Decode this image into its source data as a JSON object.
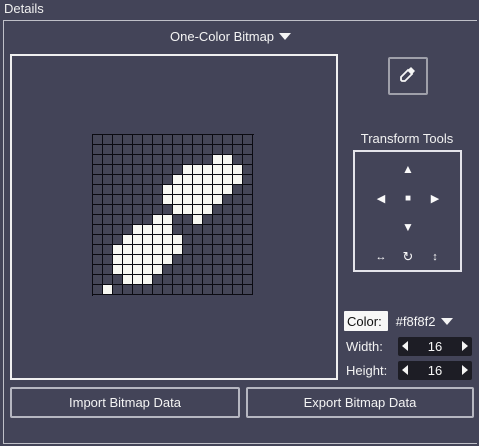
{
  "panel": {
    "title": "Details"
  },
  "mode": {
    "selected": "One-Color Bitmap",
    "icon": "chevron-down-icon"
  },
  "bitmap": {
    "rows": [
      "0000000000000000",
      "0000000000000000",
      "0000000000001100",
      "0000000001111110",
      "0000000011111110",
      "0000000111111100",
      "0000000111111000",
      "0000000011110000",
      "0000001100100000",
      "0000111100000000",
      "0001111110000000",
      "0011111110000000",
      "0011111100000000",
      "0011111000000000",
      "0001110000000000",
      "0100000000000000"
    ],
    "on_color": "#f8f8f2",
    "off_color": "#454657"
  },
  "picker": {
    "icon": "eyedropper-icon"
  },
  "transform": {
    "label": "Transform Tools",
    "buttons": {
      "up": "▲",
      "left": "◀",
      "center": "■",
      "right": "▶",
      "down": "▼",
      "flip_h": "↔",
      "rotate": "↻",
      "flip_v": "↕"
    }
  },
  "color": {
    "label": "Color:",
    "value": "#f8f8f2"
  },
  "width": {
    "label": "Width:",
    "value": "16"
  },
  "height": {
    "label": "Height:",
    "value": "16"
  },
  "actions": {
    "import": "Import Bitmap Data",
    "export": "Export Bitmap Data"
  }
}
